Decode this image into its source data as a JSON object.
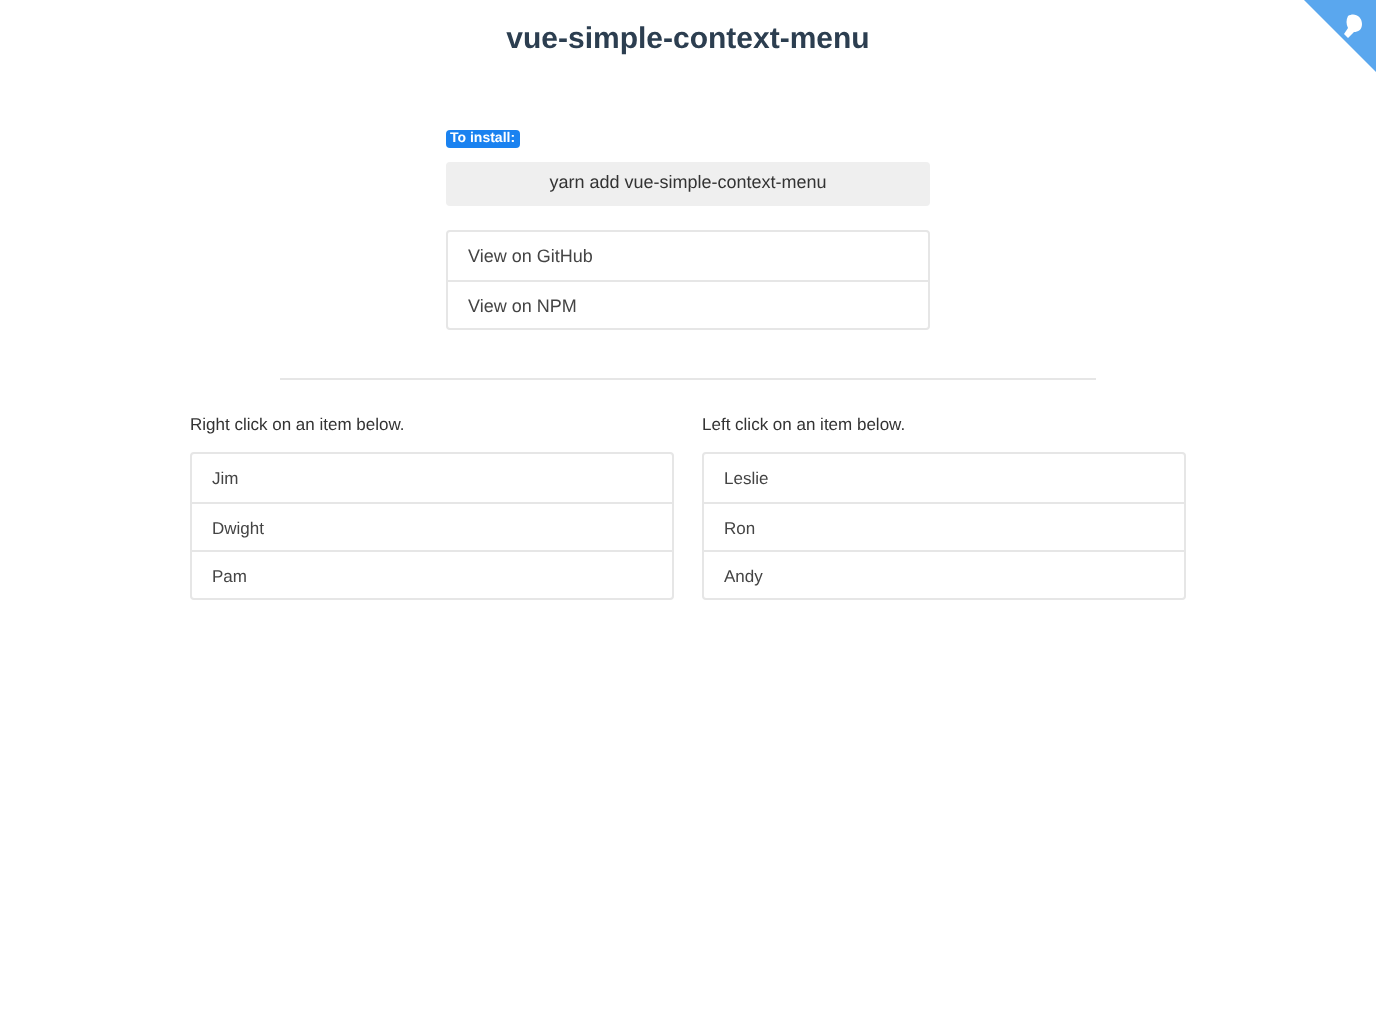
{
  "title": "vue-simple-context-menu",
  "install": {
    "label": "To install:",
    "command": "yarn add vue-simple-context-menu"
  },
  "links": [
    "View on GitHub",
    "View on NPM"
  ],
  "lists": [
    {
      "caption": "Right click on an item below.",
      "items": [
        "Jim",
        "Dwight",
        "Pam"
      ]
    },
    {
      "caption": "Left click on an item below.",
      "items": [
        "Leslie",
        "Ron",
        "Andy"
      ]
    }
  ]
}
